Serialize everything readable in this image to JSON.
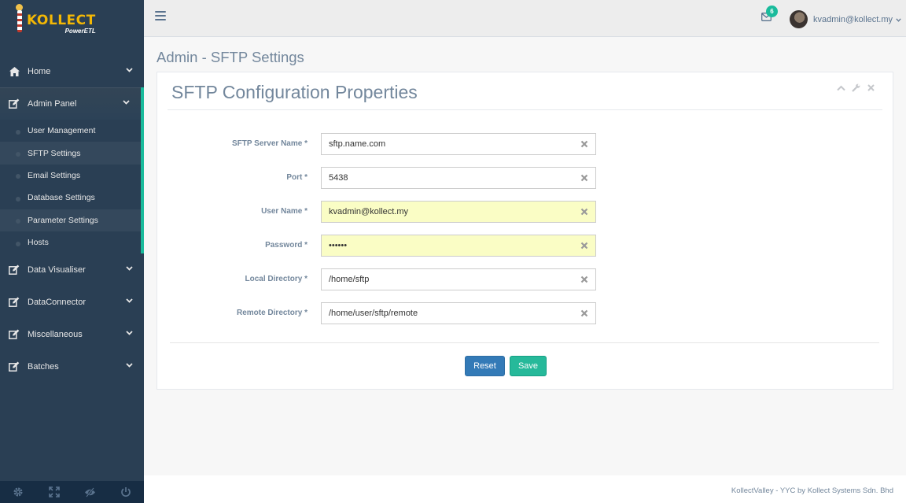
{
  "brand": {
    "title": "KOLLECT",
    "subtitle": "PowerETL",
    "title_color": "#f2b705"
  },
  "sidebar": {
    "items": [
      {
        "label": "Home",
        "icon": "home-icon"
      },
      {
        "label": "Admin Panel",
        "icon": "edit-icon",
        "expanded": true
      },
      {
        "label": "Data Visualiser",
        "icon": "edit-icon"
      },
      {
        "label": "DataConnector",
        "icon": "edit-icon"
      },
      {
        "label": "Miscellaneous",
        "icon": "edit-icon"
      },
      {
        "label": "Batches",
        "icon": "edit-icon"
      }
    ],
    "admin_submenu": [
      {
        "label": "User Management"
      },
      {
        "label": "SFTP Settings",
        "active": true
      },
      {
        "label": "Email Settings"
      },
      {
        "label": "Database Settings"
      },
      {
        "label": "Parameter Settings"
      },
      {
        "label": "Hosts"
      }
    ],
    "footer_icons": [
      "settings-icon",
      "fullscreen-icon",
      "eye-slash-icon",
      "power-icon"
    ],
    "accent_color": "#1abb9c"
  },
  "topbar": {
    "notification_count": "6",
    "user_name": "kvadmin@kollect.my"
  },
  "page": {
    "title": "Admin - SFTP Settings"
  },
  "panel": {
    "title": "SFTP Configuration Properties",
    "tools": [
      "chevron-up-icon",
      "wrench-icon",
      "close-icon"
    ]
  },
  "form": {
    "fields": [
      {
        "label": "SFTP Server Name *",
        "value": "sftp.name.com",
        "type": "text"
      },
      {
        "label": "Port *",
        "value": "5438",
        "type": "text"
      },
      {
        "label": "User Name *",
        "value": "kvadmin@kollect.my",
        "type": "text",
        "autofilled": true
      },
      {
        "label": "Password *",
        "value": "••••••",
        "type": "password",
        "autofilled": true
      },
      {
        "label": "Local Directory *",
        "value": "/home/sftp",
        "type": "text"
      },
      {
        "label": "Remote Directory *",
        "value": "/home/user/sftp/remote",
        "type": "text"
      }
    ],
    "reset_label": "Reset",
    "save_label": "Save"
  },
  "footer": {
    "text": "KollectValley - YYC by Kollect Systems Sdn. Bhd"
  }
}
